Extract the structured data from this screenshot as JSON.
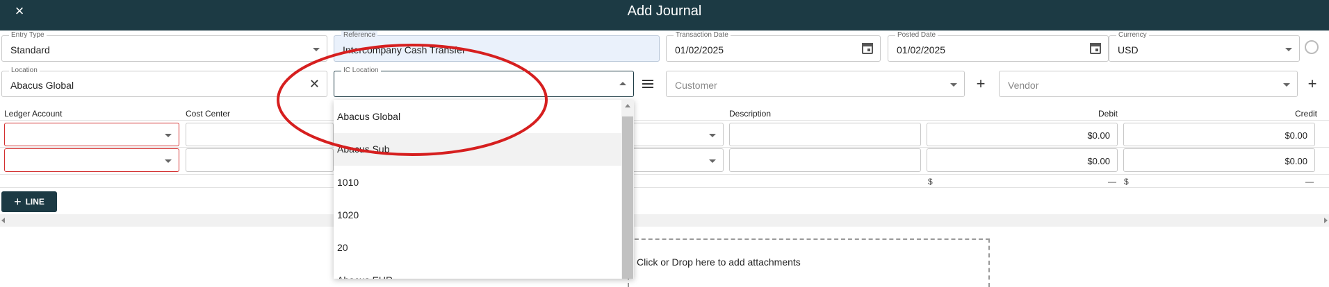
{
  "header": {
    "title": "Add Journal",
    "close_icon": "×"
  },
  "form": {
    "entry_type": {
      "label": "Entry Type",
      "value": "Standard"
    },
    "reference": {
      "label": "Reference",
      "value": "Intercompany Cash Transfer"
    },
    "transaction_date": {
      "label": "Transaction Date",
      "value": "01/02/2025"
    },
    "posted_date": {
      "label": "Posted Date",
      "value": "01/02/2025"
    },
    "currency": {
      "label": "Currency",
      "value": "USD"
    },
    "location": {
      "label": "Location",
      "value": "Abacus Global",
      "clear_icon": "✕"
    },
    "ic_location": {
      "label": "IC Location",
      "value": ""
    },
    "customer": {
      "placeholder": "Customer",
      "add_icon": "+"
    },
    "vendor": {
      "placeholder": "Vendor",
      "add_icon": "+"
    }
  },
  "lines": {
    "headers": {
      "ledger_account": "Ledger Account",
      "cost_center": "Cost Center",
      "description": "Description",
      "debit": "Debit",
      "credit": "Credit"
    },
    "rows": [
      {
        "debit": "$0.00",
        "credit": "$0.00"
      },
      {
        "debit": "$0.00",
        "credit": "$0.00"
      }
    ],
    "totals": {
      "debit_symbol": "$",
      "debit_value": "—",
      "credit_symbol": "$",
      "credit_value": "—"
    },
    "add_line_button": {
      "icon": "+",
      "label": "LINE"
    }
  },
  "attachments": {
    "text": "Click or Drop here to add attachments"
  },
  "ic_location_dropdown": {
    "options": [
      "Abacus Global",
      "Abacus Sub",
      "1010",
      "1020",
      "20",
      "Abacus EUR"
    ],
    "hovered_index": 1
  },
  "icons": {
    "close": "close-icon",
    "calendar": "calendar-icon",
    "sync": "sync-icon",
    "list": "list-icon",
    "add": "plus-icon"
  },
  "colors": {
    "header": "#1c3a44",
    "error": "#d32f2f",
    "highlight": "#eaf1fb"
  }
}
